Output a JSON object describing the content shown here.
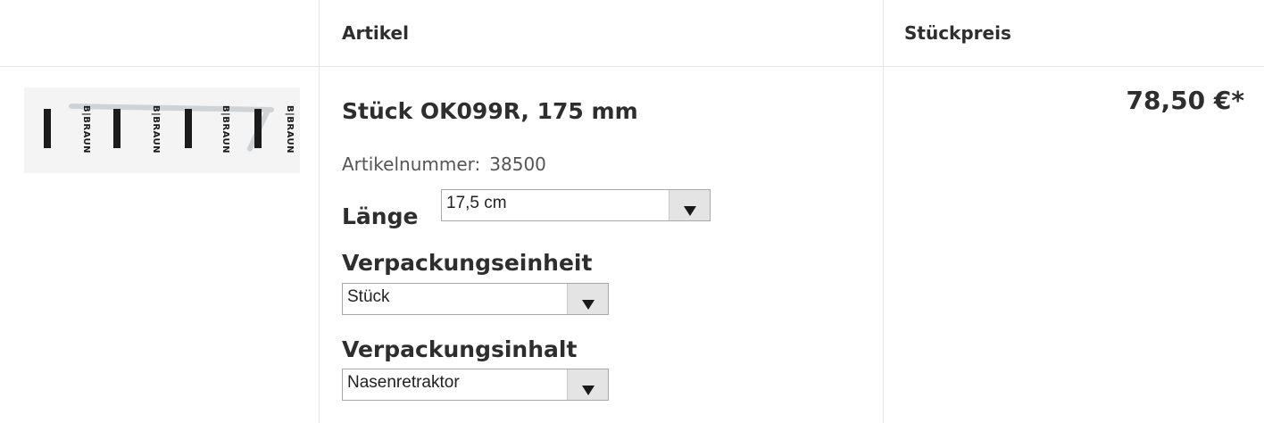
{
  "table": {
    "headers": {
      "article": "Artikel",
      "unit_price": "Stückpreis"
    }
  },
  "product": {
    "image_brand": "B|BRAUN",
    "name": "Stück OK099R, 175 mm",
    "article_number_label": "Artikelnummer:",
    "article_number": "38500",
    "price": "78,50 €*"
  },
  "options": {
    "length": {
      "label": "Länge",
      "value": "17,5 cm"
    },
    "packaging_unit": {
      "label": "Verpackungseinheit",
      "value": "Stück"
    },
    "packaging_content": {
      "label": "Verpackungsinhalt",
      "value": "Nasenretraktor"
    }
  }
}
